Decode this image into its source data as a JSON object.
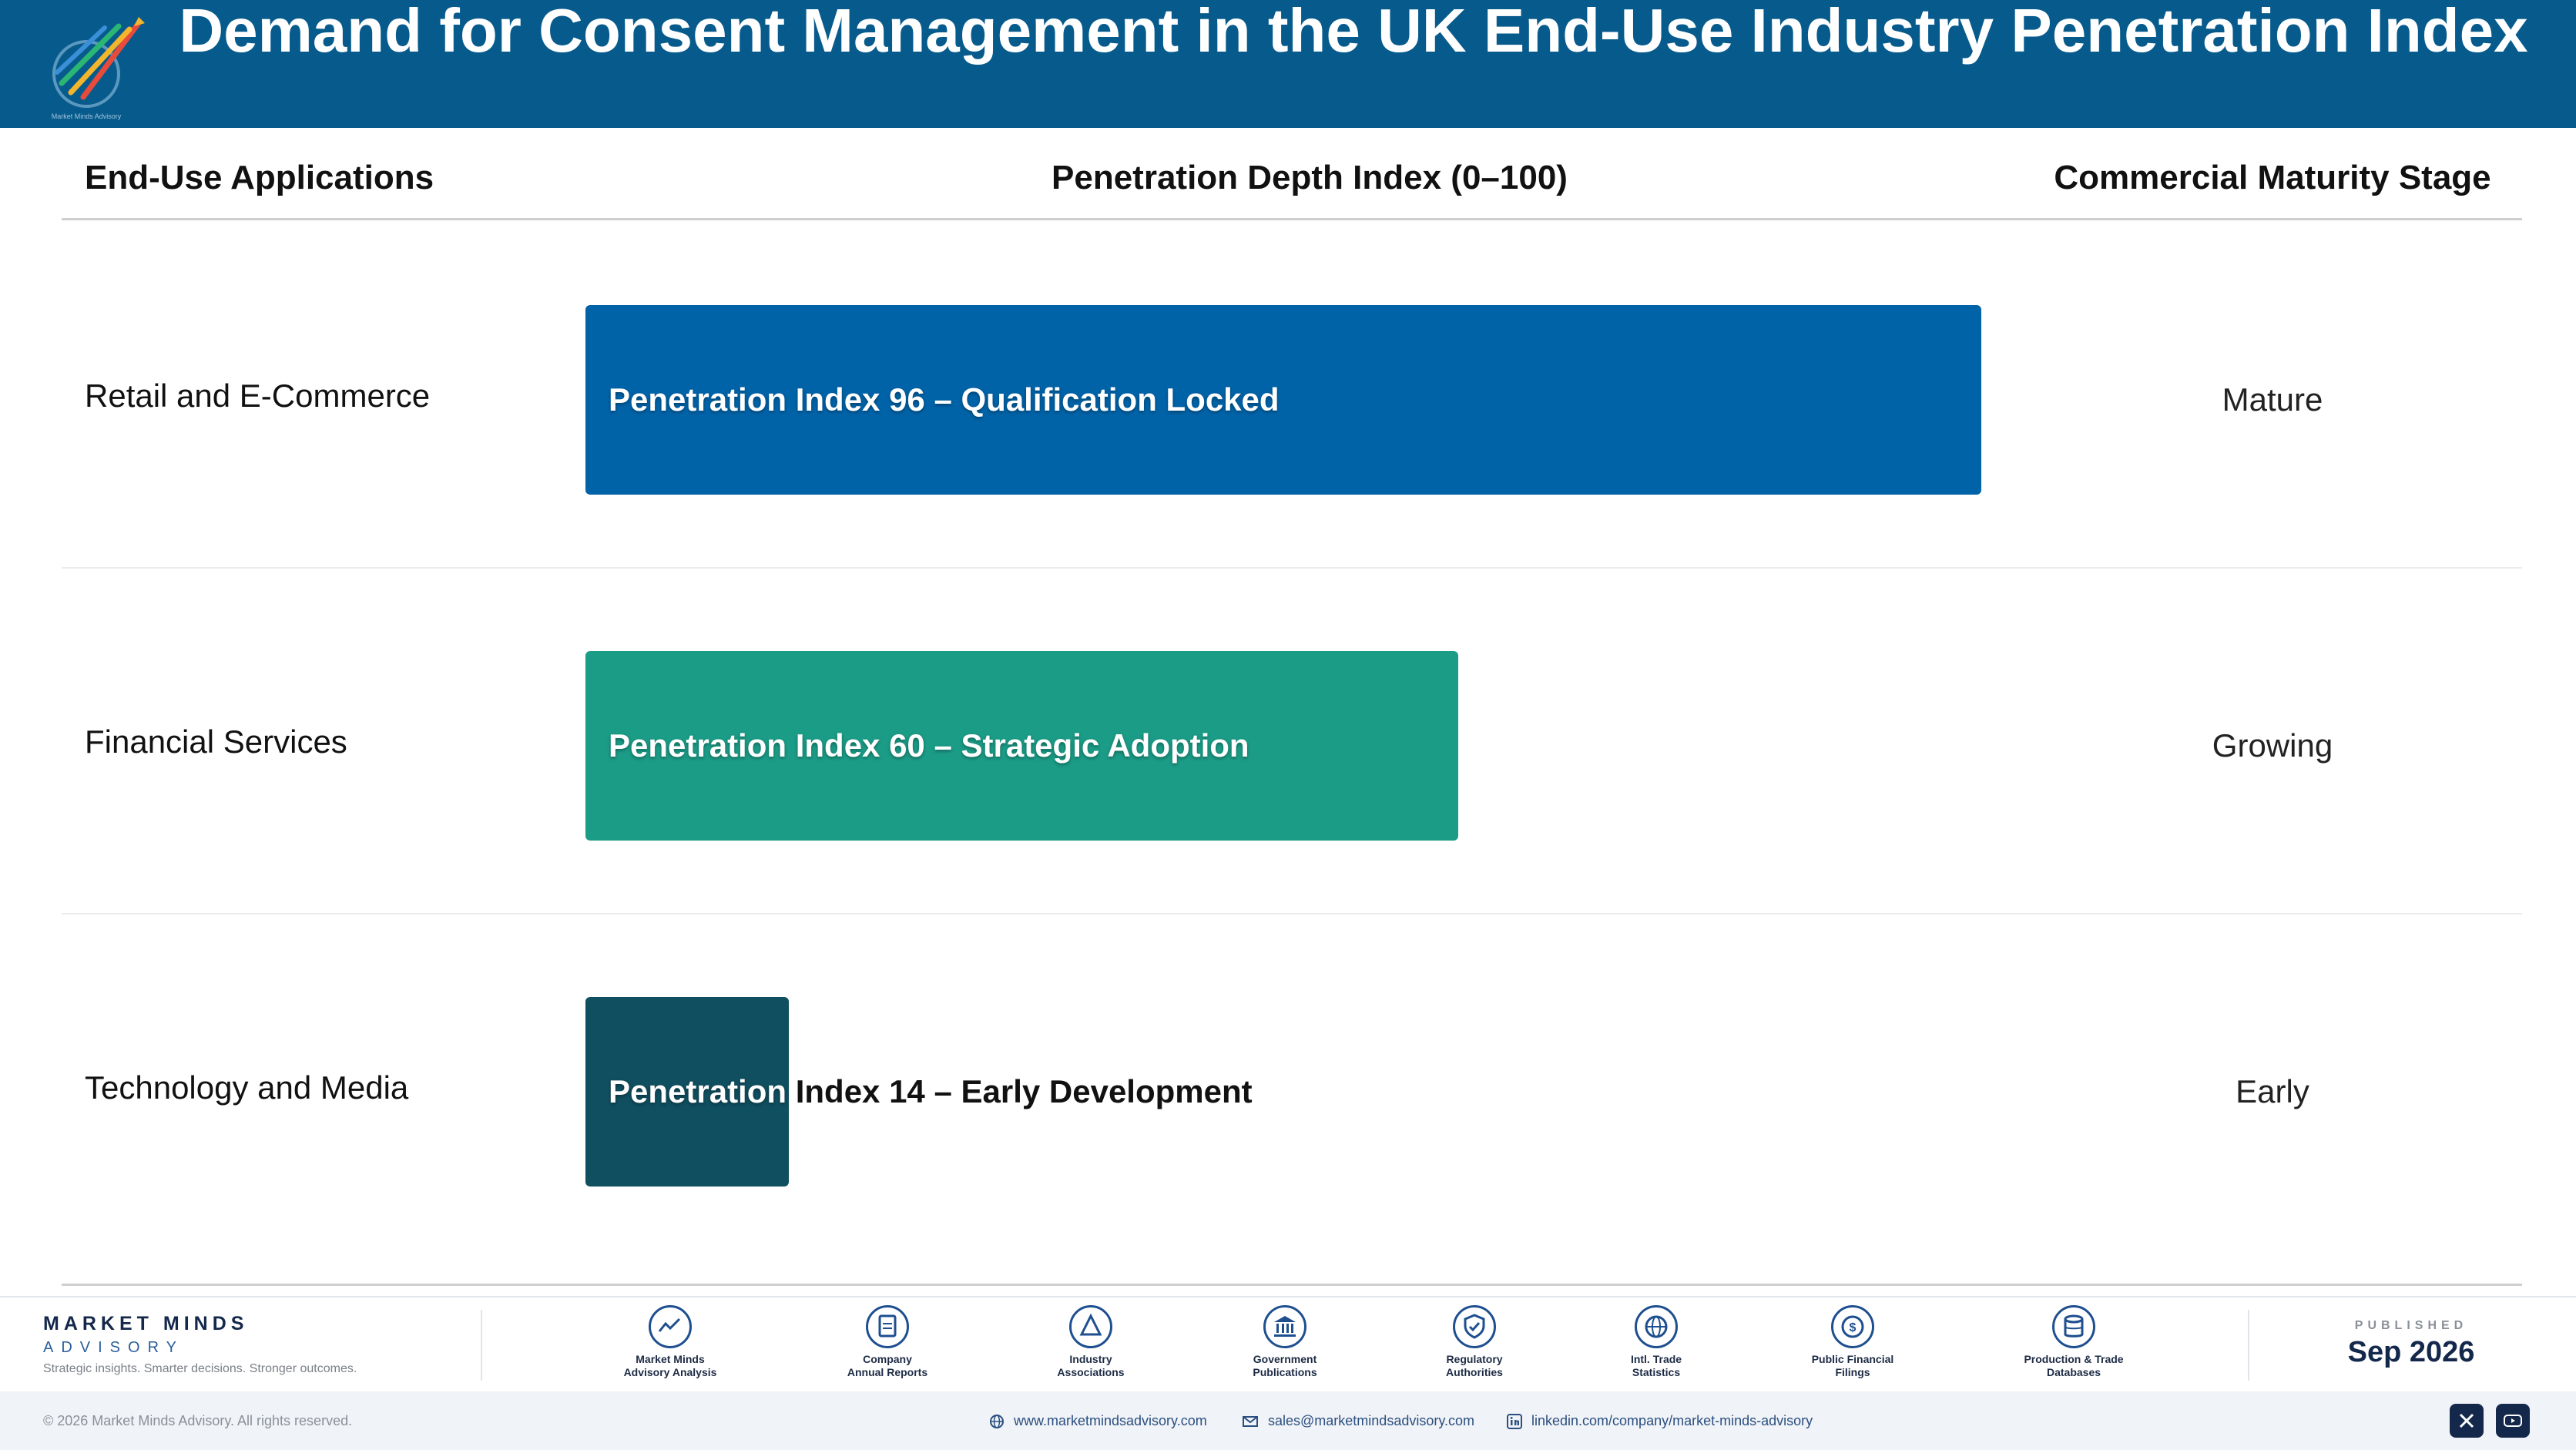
{
  "header": {
    "title": "Demand for Consent Management in the UK End-Use Industry Penetration Index",
    "logo_text": "Market Minds Advisory"
  },
  "table": {
    "col_app": "End-Use Applications",
    "col_penetration": "Penetration Depth Index (0–100)",
    "col_stage": "Commercial Maturity Stage"
  },
  "chart_data": {
    "type": "bar",
    "orientation": "horizontal",
    "categories": [
      "Retail and E-Commerce",
      "Financial Services",
      "Technology and Media"
    ],
    "values": [
      96,
      60,
      14
    ],
    "xlim": [
      0,
      100
    ],
    "bar_labels": [
      "Penetration Index 96 – Qualification Locked",
      "Penetration Index 60 – Strategic Adoption",
      "Penetration Index 14 – Early Development"
    ],
    "stages": [
      "Mature",
      "Growing",
      "Early"
    ],
    "colors": [
      "#0063a8",
      "#1b9c87",
      "#0f4f60"
    ],
    "grid": false
  },
  "footer": {
    "brand_name": "MARKET MINDS",
    "brand_sub": "ADVISORY",
    "brand_tag": "Strategic insights. Smarter decisions. Stronger outcomes.",
    "sources": [
      {
        "icon": "trend-chart-icon",
        "line1": "Market Minds",
        "line2": "Advisory Analysis"
      },
      {
        "icon": "document-icon",
        "line1": "Company",
        "line2": "Annual Reports"
      },
      {
        "icon": "network-icon",
        "line1": "Industry",
        "line2": "Associations"
      },
      {
        "icon": "government-building-icon",
        "line1": "Government",
        "line2": "Publications"
      },
      {
        "icon": "shield-check-icon",
        "line1": "Regulatory",
        "line2": "Authorities"
      },
      {
        "icon": "globe-icon",
        "line1": "Intl. Trade",
        "line2": "Statistics"
      },
      {
        "icon": "dollar-coin-icon",
        "line1": "Public Financial",
        "line2": "Filings"
      },
      {
        "icon": "database-icon",
        "line1": "Production & Trade",
        "line2": "Databases"
      }
    ],
    "published_label": "PUBLISHED",
    "published_date": "Sep 2026",
    "copyright": "© 2026 Market Minds Advisory. All rights reserved.",
    "website": "www.marketmindsadvisory.com",
    "email": "sales@marketmindsadvisory.com",
    "linkedin": "linkedin.com/company/market-minds-advisory"
  }
}
